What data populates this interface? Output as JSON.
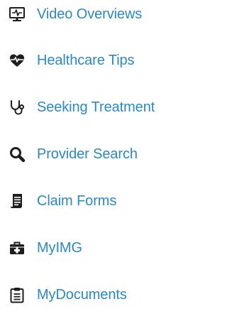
{
  "theme": {
    "link_color": "#2a89c2",
    "icon_color": "#1e1e1e"
  },
  "menu": {
    "items": [
      {
        "label": "Video Overviews",
        "icon": "monitor-heartbeat-icon"
      },
      {
        "label": "Healthcare Tips",
        "icon": "heartbeat-icon"
      },
      {
        "label": "Seeking Treatment",
        "icon": "stethoscope-icon"
      },
      {
        "label": "Provider Search",
        "icon": "search-icon"
      },
      {
        "label": "Claim Forms",
        "icon": "document-icon"
      },
      {
        "label": "MyIMG",
        "icon": "medical-kit-icon"
      },
      {
        "label": "MyDocuments",
        "icon": "clipboard-icon"
      }
    ]
  }
}
